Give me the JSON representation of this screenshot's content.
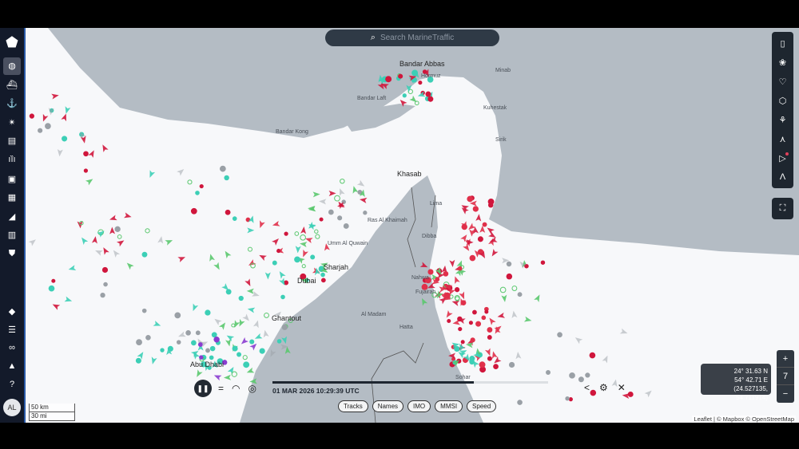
{
  "search": {
    "placeholder": "Search MarineTraffic",
    "icon": "search-icon"
  },
  "sidebar": {
    "logo": "marinetraffic-logo",
    "items": [
      {
        "name": "live-map",
        "icon": "globe-icon",
        "active": true
      },
      {
        "name": "vessels",
        "icon": "ship-icon"
      },
      {
        "name": "ports",
        "icon": "anchor-icon"
      },
      {
        "name": "lighthouses",
        "icon": "lighthouse-icon"
      },
      {
        "name": "reports",
        "icon": "report-icon"
      },
      {
        "name": "stations",
        "icon": "antenna-icon"
      },
      {
        "name": "photos",
        "icon": "photo-icon"
      },
      {
        "name": "news",
        "icon": "news-icon"
      },
      {
        "name": "voyages",
        "icon": "ramp-icon"
      },
      {
        "name": "barcode",
        "icon": "barcode-icon"
      },
      {
        "name": "security",
        "icon": "shield-icon"
      }
    ],
    "bottom_items": [
      {
        "name": "tags",
        "icon": "tag-icon"
      },
      {
        "name": "data",
        "icon": "database-icon"
      },
      {
        "name": "integrations",
        "icon": "link-icon"
      },
      {
        "name": "notifications",
        "icon": "bell-icon"
      },
      {
        "name": "help",
        "icon": "help-icon"
      }
    ],
    "avatar": "AL"
  },
  "right_toolbar": [
    "map-book-icon",
    "layers-icon",
    "heart-icon",
    "cube-icon",
    "filter-icon",
    "measure-icon",
    "play-icon",
    "navigation-icon"
  ],
  "fullscreen_icon": "fullscreen-icon",
  "zoom": {
    "plus": "+",
    "level": "7",
    "minus": "−"
  },
  "coords": {
    "lat": "24° 31.63 N",
    "lon": "54° 42.71 E",
    "decimal": "(24.527135, 54.711914)"
  },
  "playback": {
    "timestamp": "01 MAR 2026 10:29:39 UTC",
    "progress": 0.73
  },
  "chips": [
    "Tracks",
    "Names",
    "IMO",
    "MMSI",
    "Speed"
  ],
  "scale": {
    "km": "50 km",
    "mi": "30 mi"
  },
  "attribution": "Leaflet | © Mapbox © OpenStreetMap",
  "cities": [
    "Bandar Abbas",
    "Hormuz",
    "Bandar Laft",
    "Khasab",
    "Ras Al Khaimah",
    "Umm Al Quwain",
    "Sharjah",
    "Dubai",
    "Ghantout",
    "Abu Dhabi",
    "Fujairah",
    "Sohar",
    "Minab",
    "Kuhestak",
    "Sirik",
    "Bandar Kong",
    "Al Madam",
    "Hatta",
    "Dibba",
    "Nahwa",
    "Lima"
  ],
  "colors": {
    "cargo": "#d0163c",
    "tanker": "#e0304a",
    "passenger": "#3ccfb6",
    "tug": "#5ac86e",
    "pleasure": "#8a3cd0",
    "unknown": "#9aa0a6",
    "land": "#b4bcc4",
    "sea": "#f7f8fa"
  }
}
